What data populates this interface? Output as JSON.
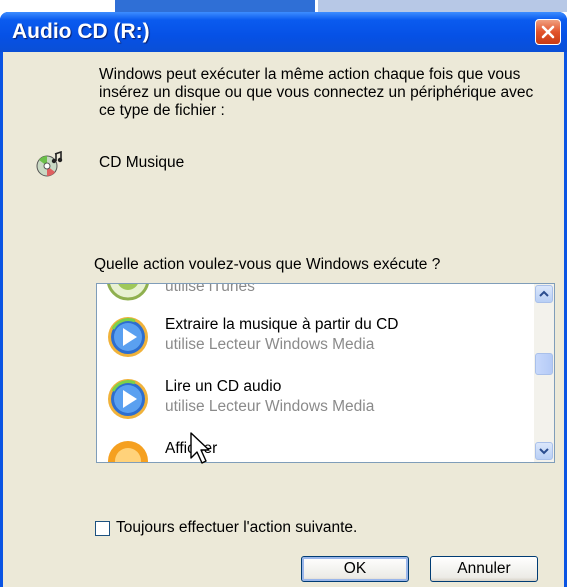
{
  "window": {
    "title": "Audio CD (R:)"
  },
  "dialog": {
    "description": "Windows peut exécuter la même action chaque fois que vous insérez un disque ou que vous connectez un périphérique avec ce type de fichier :",
    "content_type": "CD Musique",
    "question": "Quelle action voulez-vous que Windows exécute ?"
  },
  "actions": [
    {
      "name": "",
      "sub": "utilise iTunes",
      "icon": "itunes-icon"
    },
    {
      "name": "Extraire la musique à partir du CD",
      "sub": "utilise Lecteur Windows Media",
      "icon": "windows-media-player-icon"
    },
    {
      "name": "Lire un CD audio",
      "sub": "utilise Lecteur Windows Media",
      "icon": "windows-media-player-icon"
    },
    {
      "name": "Afficher",
      "sub": "",
      "icon": "media-icon"
    }
  ],
  "always": {
    "label": "Toujours effectuer l'action suivante.",
    "checked": false
  },
  "buttons": {
    "ok": "OK",
    "cancel": "Annuler"
  },
  "colors": {
    "titlebar": "#0a54e3",
    "client": "#ece9d8",
    "close": "#e2532b"
  }
}
